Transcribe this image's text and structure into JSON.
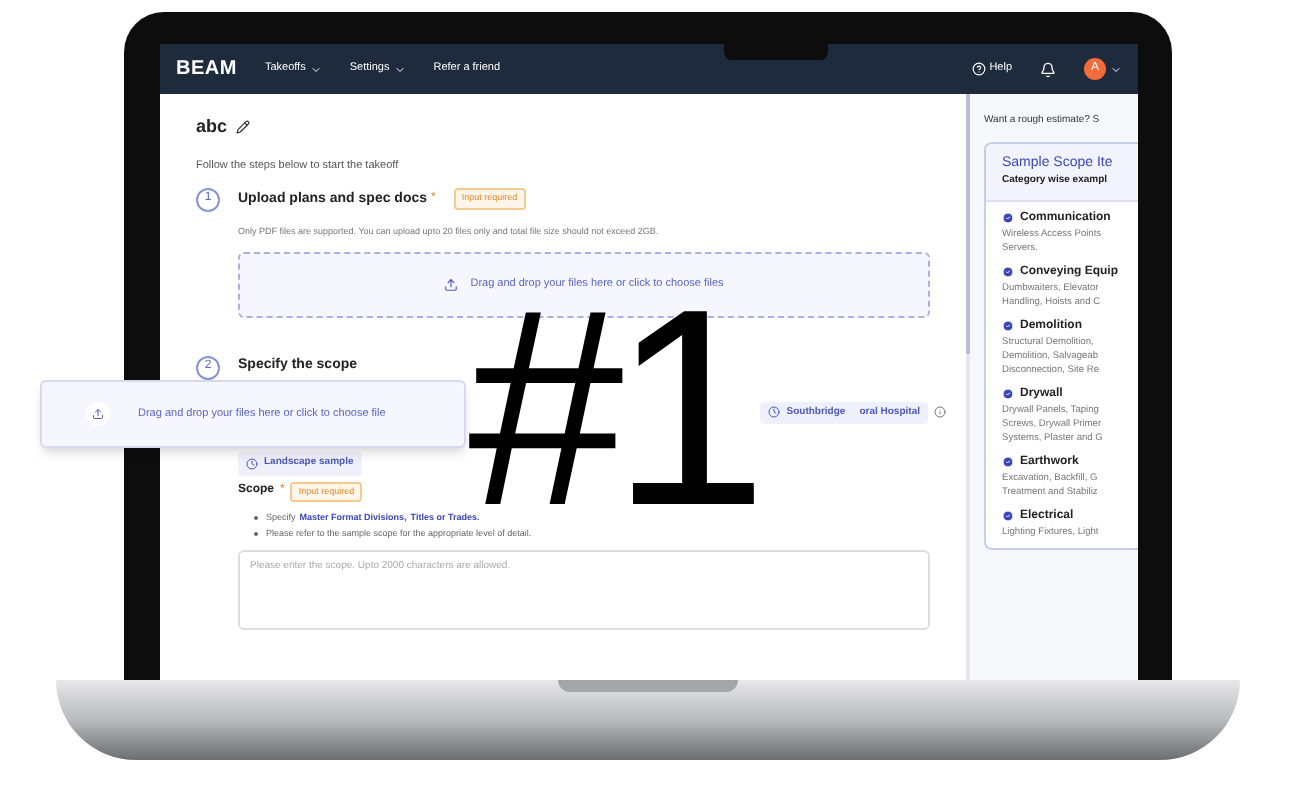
{
  "overlay_heading": "#1",
  "nav": {
    "logo": "BEAM",
    "menus": [
      {
        "label": "Takeoffs",
        "dropdown": true
      },
      {
        "label": "Settings",
        "dropdown": true
      },
      {
        "label": "Refer a friend",
        "dropdown": false
      }
    ],
    "help": "Help",
    "avatar": "A"
  },
  "project": {
    "title": "abc",
    "intro": "Follow the steps below to start the takeoff"
  },
  "step_1": {
    "number": "1",
    "title": "Upload plans and spec docs",
    "required_mark": "*",
    "badge": "Input required",
    "note": "Only PDF files are supported. You can upload upto 20 files only and total file size should not exceed 2GB.",
    "dropzone": "Drag and drop your files here or click to choose files"
  },
  "step_2": {
    "number": "2",
    "title": "Specify the scope",
    "samples": [
      {
        "parts": [
          "Southbridge",
          "oral Hospital"
        ]
      },
      {
        "parts": [
          "Landscape sample"
        ]
      }
    ],
    "scope": {
      "label": "Scope",
      "required_mark": "*",
      "badge": "Input required",
      "bullets": [
        {
          "text": "Specify",
          "links": [
            "Master Format Divisions,",
            "Titles or Trades."
          ]
        },
        {
          "text": "Please refer to the sample scope for the appropriate level of detail."
        }
      ],
      "placeholder": "Please enter the scope. Upto 2000 characters are allowed."
    }
  },
  "floating_card": {
    "text": "Drag and drop your files here or click to choose file"
  },
  "side_panel": {
    "prompt": "Want a rough estimate? S",
    "title": "Sample Scope Ite",
    "subtitle": "Category wise exampl",
    "categories": [
      {
        "name": "Communication",
        "lines": [
          "Wireless Access Points",
          "Servers."
        ]
      },
      {
        "name": "Conveying Equip",
        "lines": [
          "Dumbwaiters, Elevator",
          "Handling, Hoists and C"
        ]
      },
      {
        "name": "Demolition",
        "lines": [
          "Structural Demolition,",
          "Demolition, Salvageab",
          "Disconnection, Site Re"
        ]
      },
      {
        "name": "Drywall",
        "lines": [
          "Drywall Panels, Taping",
          "Screws, Drywall Primer",
          "Systems, Plaster and G"
        ]
      },
      {
        "name": "Earthwork",
        "lines": [
          "Excavation, Backfill, G",
          "Treatment and Stabiliz"
        ]
      },
      {
        "name": "Electrical",
        "lines": [
          "Lighting Fixtures, Light"
        ]
      }
    ]
  }
}
